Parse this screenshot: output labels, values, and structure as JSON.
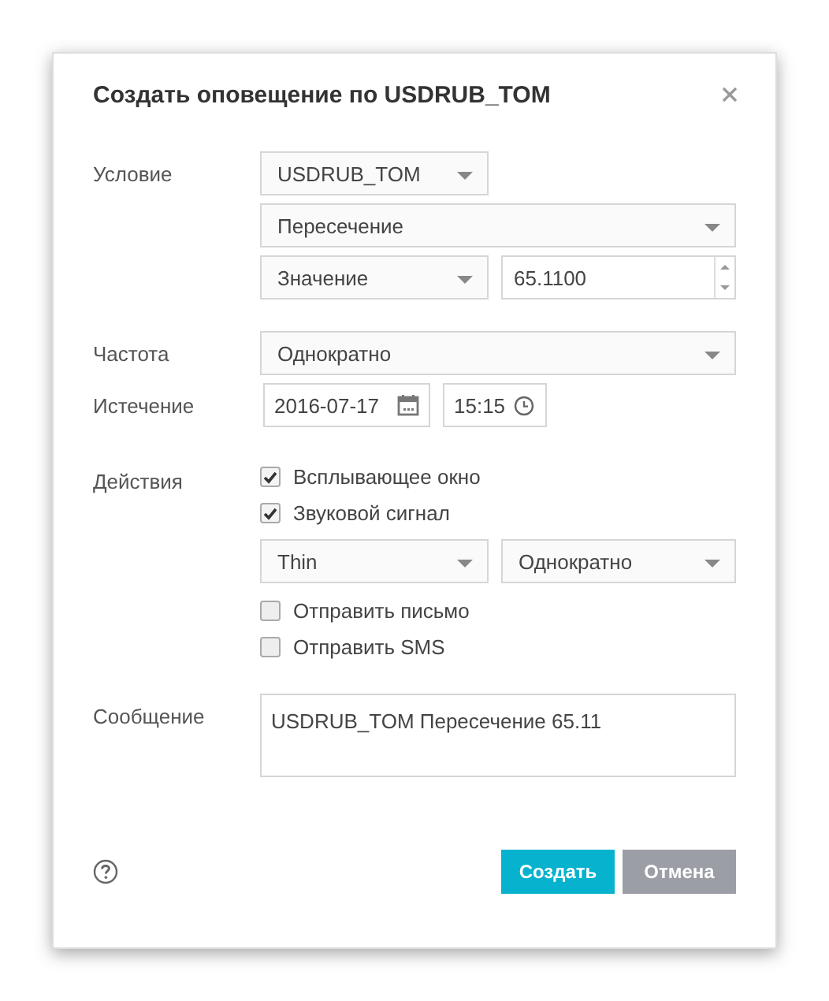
{
  "dialog": {
    "title": "Создать оповещение по USDRUB_TOM"
  },
  "condition": {
    "label": "Условие",
    "instrument": "USDRUB_TOM",
    "type": "Пересечение",
    "operand": "Значение",
    "value": "65.1100"
  },
  "frequency": {
    "label": "Частота",
    "value": "Однократно"
  },
  "expiry": {
    "label": "Истечение",
    "date": "2016-07-17",
    "time": "15:15"
  },
  "actions": {
    "label": "Действия",
    "items": [
      {
        "kind": "checkbox",
        "label": "Всплывающее окно",
        "checked": true
      },
      {
        "kind": "checkbox",
        "label": "Звуковой сигнал",
        "checked": true
      },
      {
        "kind": "selects",
        "sound": "Thin",
        "repeat": "Однократно"
      },
      {
        "kind": "checkbox",
        "label": "Отправить письмо",
        "checked": false
      },
      {
        "kind": "checkbox",
        "label": "Отправить SMS",
        "checked": false
      }
    ]
  },
  "message": {
    "label": "Сообщение",
    "value": "USDRUB_TOM Пересечение 65.11"
  },
  "buttons": [
    {
      "label": "Создать",
      "kind": "primary"
    },
    {
      "label": "Отмена",
      "kind": "secondary"
    }
  ]
}
